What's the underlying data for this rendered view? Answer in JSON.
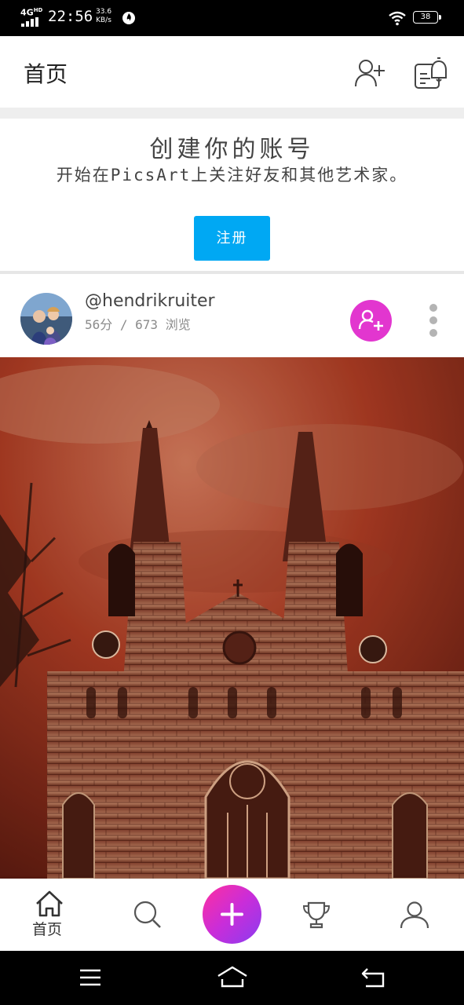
{
  "status_bar": {
    "network": "4G",
    "network_tag": "HD",
    "time": "22:56",
    "speed_value": "33.6",
    "speed_unit": "KB/s",
    "battery": "38"
  },
  "header": {
    "title": "首页",
    "add_friend_icon": "person-plus-icon",
    "notification_icon": "notification-bell-icon"
  },
  "signup_banner": {
    "title": "创建你的账号",
    "subtitle": "开始在PicsArt上关注好友和其他艺术家。",
    "button_label": "注册"
  },
  "post": {
    "username": "@hendrikruiter",
    "meta": "56分 / 673 浏览",
    "follow_icon": "follow-person-plus-icon",
    "more_icon": "more-vertical-icon",
    "image_subject": "gothic cathedral with two spires under red sky"
  },
  "bottom_nav": {
    "home_label": "首页",
    "items": [
      "home-icon",
      "search-icon",
      "add-icon",
      "trophy-icon",
      "profile-icon"
    ]
  },
  "system_nav": {
    "items": [
      "menu-icon",
      "home-outline-icon",
      "back-icon"
    ]
  },
  "colors": {
    "accent_blue": "#00a8f3",
    "follow_pink": "#e236cf",
    "fab_gradient_start": "#ff2f9f",
    "fab_gradient_end": "#8a3cf0"
  }
}
